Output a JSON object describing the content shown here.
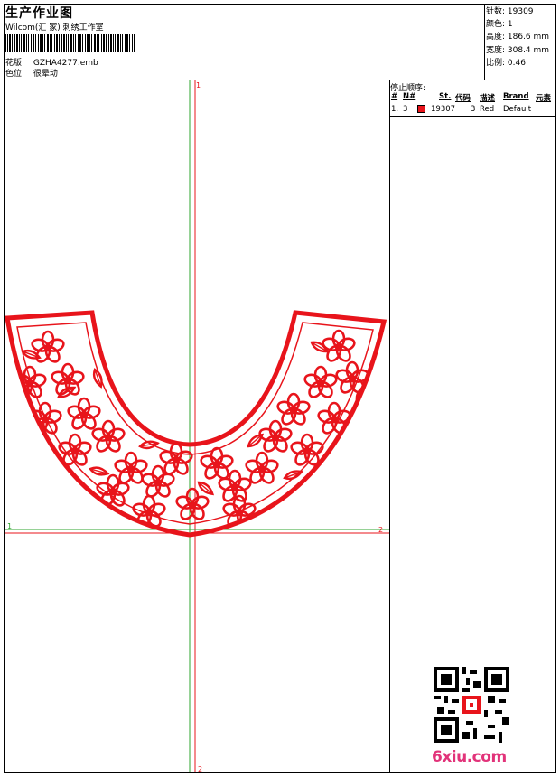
{
  "header": {
    "title": "生产作业图",
    "subtitle": "Wilcom(汇 家) 刺绣工作室",
    "design_label": "花版:",
    "design_value": "GZHA4277.emb",
    "color_label": "色位:",
    "color_value": "很晕动"
  },
  "specs": {
    "stitches": "针数: 19309",
    "colors": "颜色: 1",
    "height": "高度: 186.6 mm",
    "width": "宽度: 308.4 mm",
    "scale": "比例: 0.46"
  },
  "stop_sequence": {
    "title": "停止顺序:",
    "headers": [
      "#",
      "N#",
      "St.",
      "代码",
      "描述",
      "Brand",
      "元素"
    ],
    "rows": [
      {
        "index": "1.",
        "needle": "3",
        "stitches": "19307",
        "code": "3",
        "description": "Red",
        "brand": "Default",
        "swatch_color": "#e8141b"
      }
    ]
  },
  "canvas": {
    "axis_label_1_top": "1",
    "axis_label_1_left": "1",
    "axis_label_2_right": "2",
    "axis_label_2_bottom": "2"
  },
  "colors": {
    "embroidery": "#e8141b",
    "guide_red": "#e8141b",
    "guide_green": "#2ea52e"
  },
  "watermark": {
    "text": "6xiu.com"
  }
}
